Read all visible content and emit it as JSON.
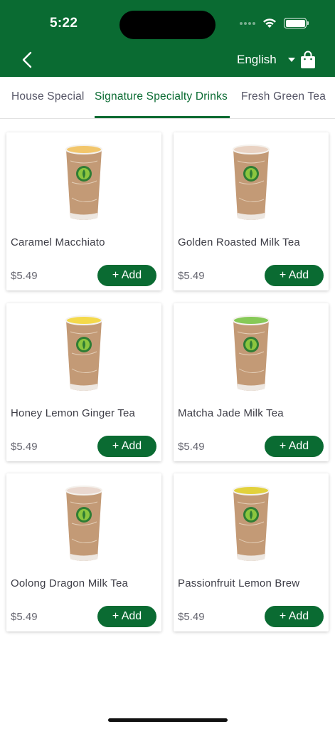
{
  "status_bar": {
    "time": "5:22"
  },
  "header": {
    "language": "English"
  },
  "tabs": [
    {
      "label": "House Special",
      "active": false
    },
    {
      "label": "Signature Specialty Drinks",
      "active": true
    },
    {
      "label": "Fresh Green Tea",
      "active": false
    }
  ],
  "products": [
    {
      "name": "Caramel Macchiato",
      "price": "$5.49",
      "add_label": "+ Add",
      "drink_color": "#f2c66b"
    },
    {
      "name": "Golden Roasted Milk Tea",
      "price": "$5.49",
      "add_label": "+ Add",
      "drink_color": "#e9d2c2"
    },
    {
      "name": "Honey Lemon Ginger Tea",
      "price": "$5.49",
      "add_label": "+ Add",
      "drink_color": "#f4d94a"
    },
    {
      "name": "Matcha Jade Milk Tea",
      "price": "$5.49",
      "add_label": "+ Add",
      "drink_color": "#86c957"
    },
    {
      "name": "Oolong Dragon Milk Tea",
      "price": "$5.49",
      "add_label": "+ Add",
      "drink_color": "#ead8cf"
    },
    {
      "name": "Passionfruit Lemon Brew",
      "price": "$5.49",
      "add_label": "+ Add",
      "drink_color": "#e2d13c"
    }
  ],
  "colors": {
    "brand": "#0a6b32",
    "cup": "#c39a76"
  },
  "icons": {
    "back": "chevron-left-icon",
    "language_dropdown": "caret-down-icon",
    "cart": "shopping-bag-icon",
    "wifi": "wifi-icon",
    "battery": "battery-icon"
  }
}
